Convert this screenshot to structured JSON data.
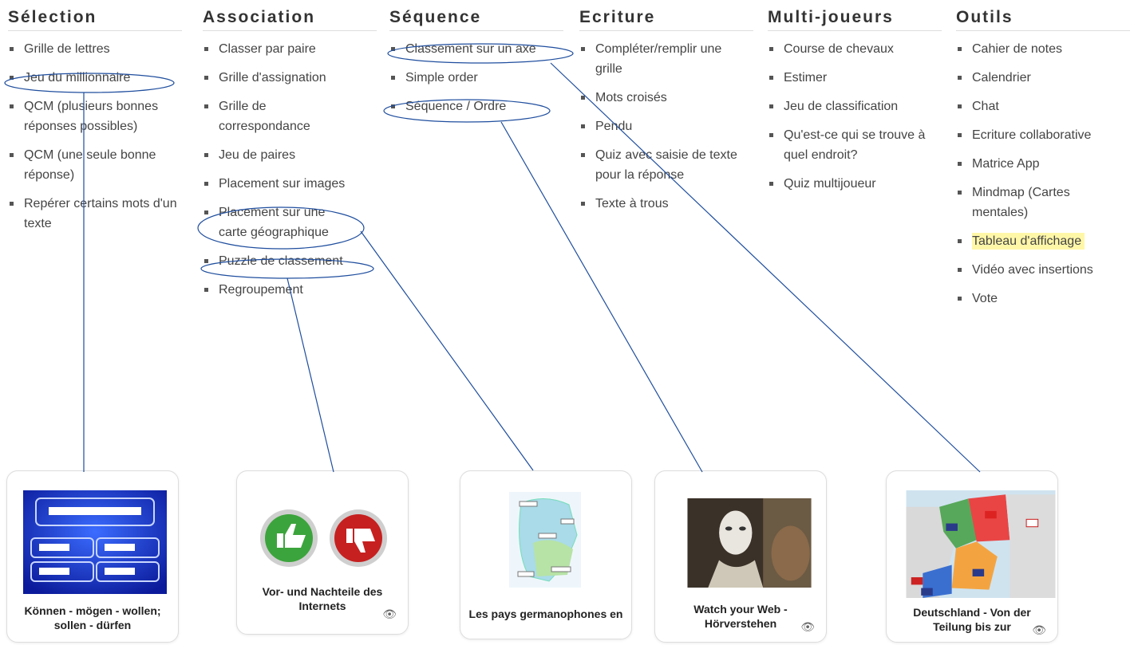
{
  "columns": [
    {
      "title": "Sélection",
      "items": [
        "Grille de lettres",
        "Jeu du millionnaire",
        "QCM (plusieurs bonnes réponses possibles)",
        "QCM (une seule bonne réponse)",
        "Repérer certains mots d'un texte"
      ]
    },
    {
      "title": "Association",
      "items": [
        "Classer par paire",
        "Grille d'assignation",
        "Grille de correspondance",
        "Jeu de paires",
        "Placement sur images",
        "Placement sur une carte géographique",
        "Puzzle de classement",
        "Regroupement"
      ]
    },
    {
      "title": "Séquence",
      "items": [
        "Classement sur un axe",
        "Simple order",
        "Séquence / Ordre"
      ]
    },
    {
      "title": "Ecriture",
      "items": [
        "Compléter/remplir une grille",
        "Mots croisés",
        "Pendu",
        "Quiz avec saisie de texte pour la réponse",
        "Texte à trous"
      ]
    },
    {
      "title": "Multi-joueurs",
      "items": [
        "Course de chevaux",
        "Estimer",
        "Jeu de classification",
        "Qu'est-ce qui se trouve à quel endroit?",
        "Quiz multijoueur"
      ]
    },
    {
      "title": "Outils",
      "items": [
        "Cahier de notes",
        "Calendrier",
        "Chat",
        "Ecriture collaborative",
        "Matrice App",
        "Mindmap (Cartes mentales)",
        "Tableau d'affichage",
        "Vidéo avec insertions",
        "Vote"
      ]
    }
  ],
  "highlight_color": "#fff7a8",
  "annotation_color": "#1f4e9e",
  "cards": [
    {
      "title": "Können - mögen - wollen; sollen - dürfen",
      "icon": "millionaire-game-thumbnail"
    },
    {
      "title": "Vor- und Nachteile des Internets",
      "icon": "thumbs-up-down-thumbnail"
    },
    {
      "title": "Les pays germanophones en",
      "icon": "map-labels-thumbnail"
    },
    {
      "title": "Watch your Web - Hörverstehen",
      "icon": "video-mask-thumbnail"
    },
    {
      "title": "Deutschland - Von der Teilung bis zur",
      "icon": "germany-map-thumbnail"
    }
  ]
}
